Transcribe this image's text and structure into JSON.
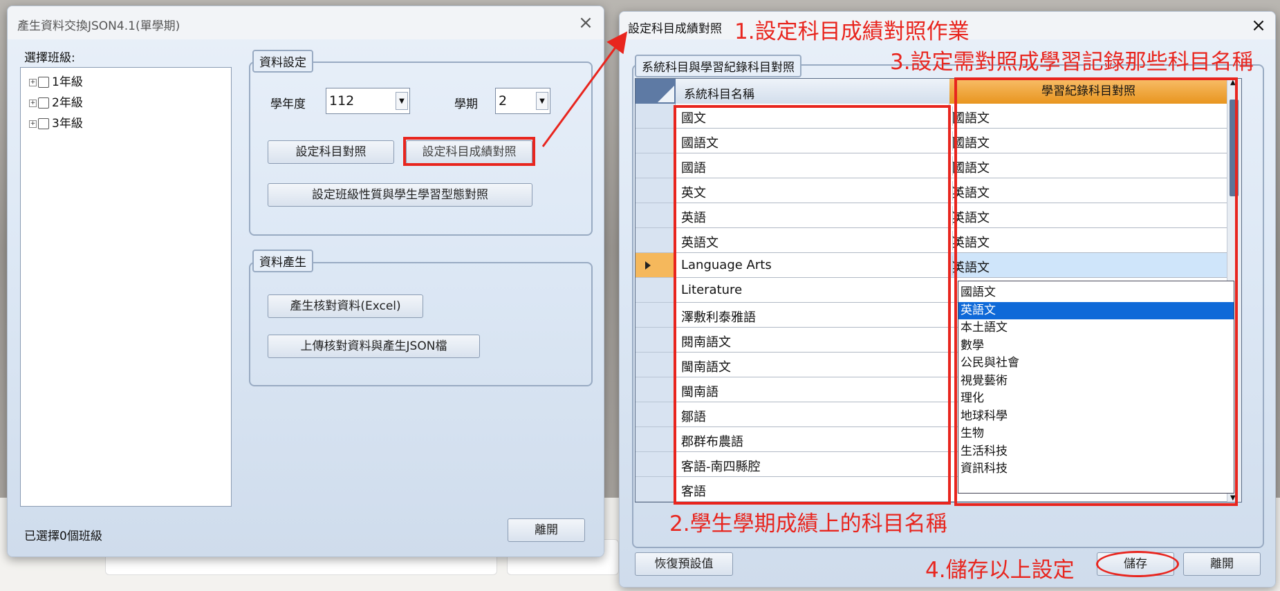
{
  "left_window": {
    "title": "產生資料交換JSON4.1(單學期)",
    "select_class_label": "選擇班級:",
    "tree_items": [
      {
        "label": "1年級"
      },
      {
        "label": "2年級"
      },
      {
        "label": "3年級"
      }
    ],
    "status": "已選擇0個班級",
    "close_label": "離開",
    "data_settings": {
      "group_label": "資料設定",
      "year_label": "學年度",
      "year_value": "112",
      "semester_label": "學期",
      "semester_value": "2",
      "subject_map_button": "設定科目對照",
      "score_map_button": "設定科目成績對照",
      "class_nature_button": "設定班級性質與學生學習型態對照"
    },
    "data_generate": {
      "group_label": "資料產生",
      "verify_button": "產生核對資料(Excel)",
      "upload_button": "上傳核對資料與產生JSON檔"
    }
  },
  "right_window": {
    "title": "設定科目成績對照",
    "group_label": "系統科目與學習紀錄科目對照",
    "col_system": "系統科目名稱",
    "col_mapping": "學習紀錄科目對照",
    "rows": [
      {
        "system": "國文",
        "mapping": "國語文"
      },
      {
        "system": "國語文",
        "mapping": "國語文"
      },
      {
        "system": "國語",
        "mapping": "國語文"
      },
      {
        "system": "英文",
        "mapping": "英語文"
      },
      {
        "system": "英語",
        "mapping": "英語文"
      },
      {
        "system": "英語文",
        "mapping": "英語文"
      },
      {
        "system": "Language Arts",
        "mapping": "英語文"
      },
      {
        "system": "Literature",
        "mapping": ""
      },
      {
        "system": "澤敷利泰雅語",
        "mapping": ""
      },
      {
        "system": "閱南語文",
        "mapping": ""
      },
      {
        "system": "閩南語文",
        "mapping": ""
      },
      {
        "system": "閩南語",
        "mapping": ""
      },
      {
        "system": "鄒語",
        "mapping": ""
      },
      {
        "system": "郡群布農語",
        "mapping": ""
      },
      {
        "system": "客語-南四縣腔",
        "mapping": ""
      },
      {
        "system": "客語",
        "mapping": ""
      }
    ],
    "dropdown_options": [
      "國語文",
      "英語文",
      "本土語文",
      "數學",
      "公民與社會",
      "視覺藝術",
      "理化",
      "地球科學",
      "生物",
      "生活科技",
      "資訊科技"
    ],
    "dropdown_selected": "英語文",
    "restore_button": "恢復預設值",
    "save_button": "儲存",
    "close_button": "離開"
  },
  "annotations": {
    "a1": "1.設定科目成績對照作業",
    "a2": "2.學生學期成績上的科目名稱",
    "a3": "3.設定需對照成學習記錄那些科目名稱",
    "a4": "4.儲存以上設定"
  },
  "colors": {
    "annotation_red": "#e8251e",
    "header_orange": "#f0a440",
    "dropdown_selection": "#0e69d8"
  }
}
